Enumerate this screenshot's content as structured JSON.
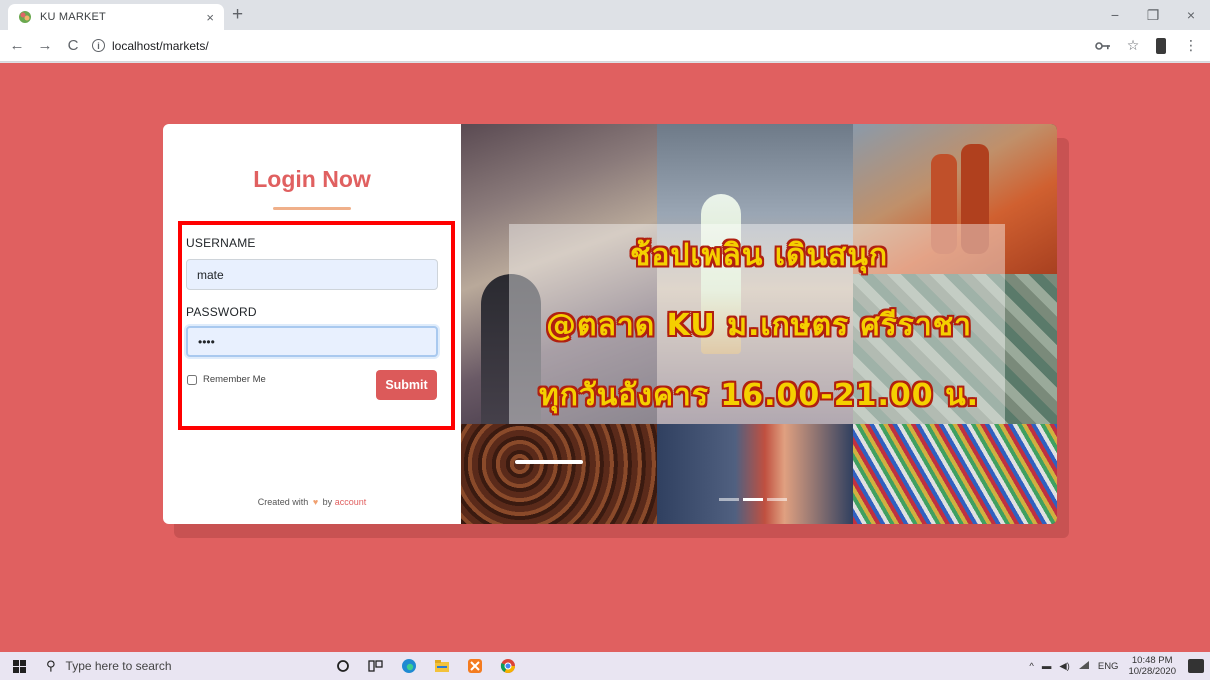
{
  "browser": {
    "tab_title": "KU MARKET",
    "tab_close": "×",
    "new_tab": "+",
    "url": "localhost/markets/",
    "controls": {
      "minimize": "−",
      "maximize": "❐",
      "close": "×"
    },
    "nav": {
      "back": "←",
      "forward": "→",
      "reload": "C"
    }
  },
  "login": {
    "title": "Login Now",
    "username_label": "USERNAME",
    "username_value": "mate",
    "password_label": "PASSWORD",
    "password_value": "pass",
    "remember_label": "Remember Me",
    "submit_label": "Submit",
    "footer_prefix": "Created with",
    "footer_by": "by",
    "footer_link": "account"
  },
  "banner": {
    "line1": "ช้อปเพลิน เดินสนุก",
    "line2": "@ตลาด KU ม.เกษตร ศรีราชา",
    "line3": "ทุกวันอังคาร 16.00-21.00 น.",
    "active_slide": 2,
    "slide_count": 3
  },
  "taskbar": {
    "search_placeholder": "Type here to search",
    "language": "ENG",
    "time": "10:48 PM",
    "date": "10/28/2020"
  },
  "colors": {
    "page_background": "#e06060",
    "accent": "#dc5a5a",
    "highlight_border": "#ff0000",
    "slogan_text": "#f5d000"
  }
}
